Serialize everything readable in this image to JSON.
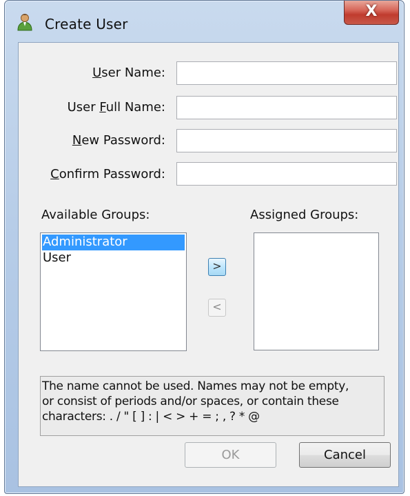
{
  "window": {
    "title": "Create User",
    "close_glyph": "X",
    "title_icon": "user-icon"
  },
  "form": {
    "user_name": {
      "label_mnemonic": "U",
      "label_rest": "ser Name:",
      "value": ""
    },
    "user_full_name": {
      "label_pre": "User ",
      "label_mnemonic": "F",
      "label_rest": "ull Name:",
      "value": ""
    },
    "new_password": {
      "label_mnemonic": "N",
      "label_rest": "ew Password:",
      "value": ""
    },
    "confirm_password": {
      "label_mnemonic": "C",
      "label_rest": "onfirm Password:",
      "value": ""
    }
  },
  "groups": {
    "available_label": "Available Groups:",
    "assigned_label": "Assigned Groups:",
    "available": [
      {
        "label": "Administrator",
        "selected": true
      },
      {
        "label": "User",
        "selected": false
      }
    ],
    "assigned": [],
    "add_button": ">",
    "remove_button": "<"
  },
  "message": {
    "line1": "The name cannot be used. Names may not be empty,",
    "line2": "or consist of periods and/or spaces, or contain these",
    "line3": "characters: . / \" [ ] : | < > + = ; , ? * @"
  },
  "buttons": {
    "ok": "OK",
    "cancel": "Cancel"
  },
  "colors": {
    "selection": "#3399ff",
    "close_button": "#c8473a",
    "title_bar": "#b9cfe9"
  }
}
